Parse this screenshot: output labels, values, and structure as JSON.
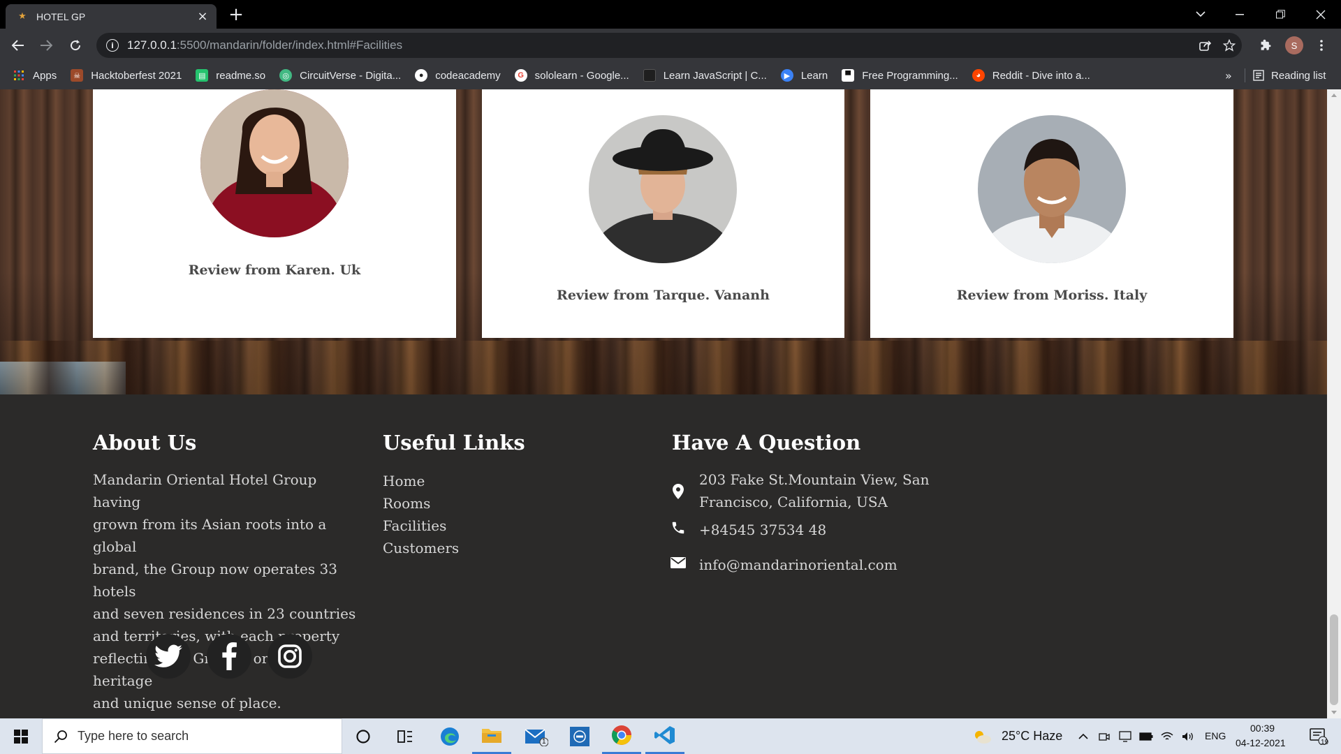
{
  "browser": {
    "tab_title": "HOTEL GP",
    "url_host": "127.0.0.1",
    "url_path": ":5500/mandarin/folder/index.html#Facilities",
    "profile_initial": "S",
    "bookmarks": [
      {
        "label": "Apps",
        "icon": "apps-grid-icon",
        "color": "#4285f4"
      },
      {
        "label": "Hacktoberfest 2021",
        "icon": "hacktoberfest-icon",
        "color": "#9c4a2a"
      },
      {
        "label": "readme.so",
        "icon": "readme-icon",
        "color": "#25c26e"
      },
      {
        "label": "CircuitVerse - Digita...",
        "icon": "circuitverse-icon",
        "color": "#42b983"
      },
      {
        "label": "codeacademy",
        "icon": "codeacademy-icon",
        "color": "#ffffff"
      },
      {
        "label": "sololearn - Google...",
        "icon": "google-icon",
        "color": "#ea4335"
      },
      {
        "label": "Learn JavaScript | C...",
        "icon": "codecademy-square-icon",
        "color": "#1f1f1f"
      },
      {
        "label": "Learn",
        "icon": "learn-icon",
        "color": "#3b82f6"
      },
      {
        "label": "Free Programming...",
        "icon": "free-programming-icon",
        "color": "#ffffff"
      },
      {
        "label": "Reddit - Dive into a...",
        "icon": "reddit-icon",
        "color": "#ff4500"
      }
    ],
    "more_bookmarks": "»",
    "reading_list": "Reading list"
  },
  "reviews": [
    {
      "title": "Review from Karen. Uk",
      "avatar": "woman-red-sweater"
    },
    {
      "title": "Review from Tarque. Vananh",
      "avatar": "man-black-hat"
    },
    {
      "title": "Review from Moriss. Italy",
      "avatar": "man-white-shirt"
    }
  ],
  "footer": {
    "about": {
      "heading": "About Us",
      "lines": [
        "Mandarin Oriental Hotel Group having",
        "grown from its Asian roots into a global",
        "brand, the Group now operates 33 hotels",
        "and seven residences in 23 countries",
        "and territories, with each property",
        "reflecting the Group’s oriental heritage",
        "and unique sense of place."
      ]
    },
    "links": {
      "heading": "Useful Links",
      "items": [
        "Home",
        "Rooms",
        "Facilities",
        "Customers"
      ]
    },
    "question": {
      "heading": "Have A Question",
      "address_lines": [
        "203 Fake St.Mountain View, San",
        "Francisco, California, USA"
      ],
      "phone": "+84545 37534 48",
      "email": "info@mandarinoriental.com"
    },
    "social": [
      "twitter-icon",
      "facebook-icon",
      "instagram-icon"
    ]
  },
  "taskbar": {
    "search_placeholder": "Type here to search",
    "weather": "25°C  Haze",
    "language": "ENG",
    "time": "00:39",
    "date": "04-12-2021",
    "notification_count": "19",
    "mail_badge": "1"
  },
  "colors": {
    "footer_bg": "#2b2a29",
    "card_bg": "#ffffff",
    "taskbar_bg": "#dde4ee"
  }
}
